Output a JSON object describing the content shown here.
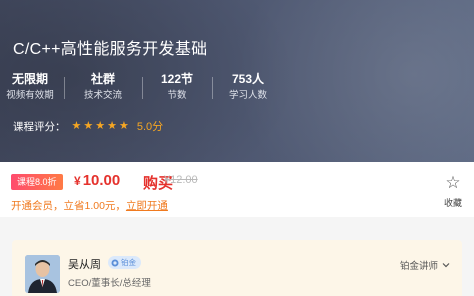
{
  "course": {
    "title": "C/C++高性能服务开发基础",
    "stats": [
      {
        "value": "无限期",
        "label": "视频有效期"
      },
      {
        "value": "社群",
        "label": "技术交流"
      },
      {
        "value": "122节",
        "label": "节数"
      },
      {
        "value": "753人",
        "label": "学习人数"
      }
    ],
    "rating_label": "课程评分：",
    "rating_stars": 5,
    "rating_value": "5.0分"
  },
  "pricing": {
    "discount_badge": "课程8.0折",
    "currency": "¥",
    "price": "10.00",
    "buy_label": "购买",
    "original_price": "¥12.00",
    "member_text": "开通会员，立省1.00元，",
    "member_link": "立即开通",
    "favorite_label": "收藏"
  },
  "teacher": {
    "name": "吴从周",
    "badge": "铂金",
    "role": "CEO/董事长/总经理",
    "level": "铂金讲师"
  },
  "colors": {
    "accent_orange": "#f5a623",
    "price_red": "#e5322d",
    "member_orange": "#f07a1f"
  }
}
